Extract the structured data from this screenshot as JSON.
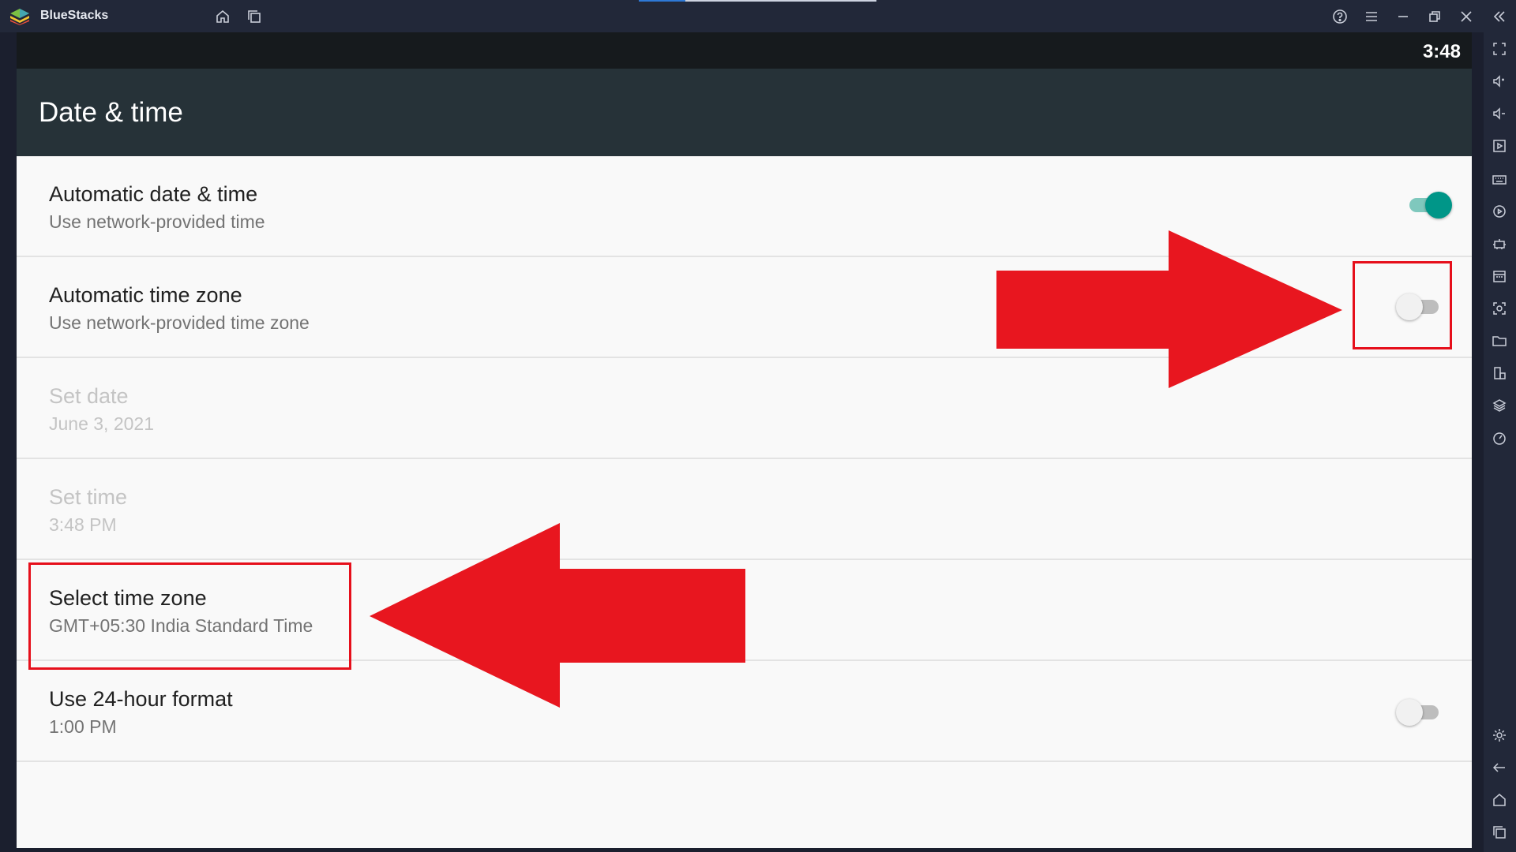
{
  "window": {
    "app_title": "BlueStacks",
    "icons": {
      "home": "home-icon",
      "multi_instance": "multi-instance-icon",
      "help": "help-icon",
      "menu": "menu-icon",
      "minimize": "minimize-icon",
      "restore": "restore-icon",
      "close": "close-icon",
      "collapse_sidebar": "collapse-sidebar-icon"
    }
  },
  "status_bar": {
    "time": "3:48"
  },
  "app_bar": {
    "title": "Date & time"
  },
  "settings": [
    {
      "title": "Automatic date & time",
      "summary": "Use network-provided time",
      "toggle": "on",
      "enabled": true
    },
    {
      "title": "Automatic time zone",
      "summary": "Use network-provided time zone",
      "toggle": "off",
      "enabled": true
    },
    {
      "title": "Set date",
      "summary": "June 3, 2021",
      "enabled": false
    },
    {
      "title": "Set time",
      "summary": "3:48 PM",
      "enabled": false
    },
    {
      "title": "Select time zone",
      "summary": "GMT+05:30 India Standard Time",
      "enabled": true
    },
    {
      "title": "Use 24-hour format",
      "summary": "1:00 PM",
      "toggle": "off",
      "enabled": true
    }
  ],
  "sidebar_tools": [
    "fullscreen-icon",
    "volume-up-icon",
    "volume-down-icon",
    "media-icon",
    "keyboard-icon",
    "macro-icon",
    "robot-icon",
    "apk-icon",
    "screenshot-icon",
    "folder-icon",
    "multi-device-icon",
    "layers-icon",
    "performance-icon",
    "settings-icon",
    "back-icon",
    "android-home-icon",
    "recents-icon"
  ],
  "colors": {
    "accent": "#009688",
    "annotation": "#e60f1b",
    "app_bar": "#263238"
  }
}
